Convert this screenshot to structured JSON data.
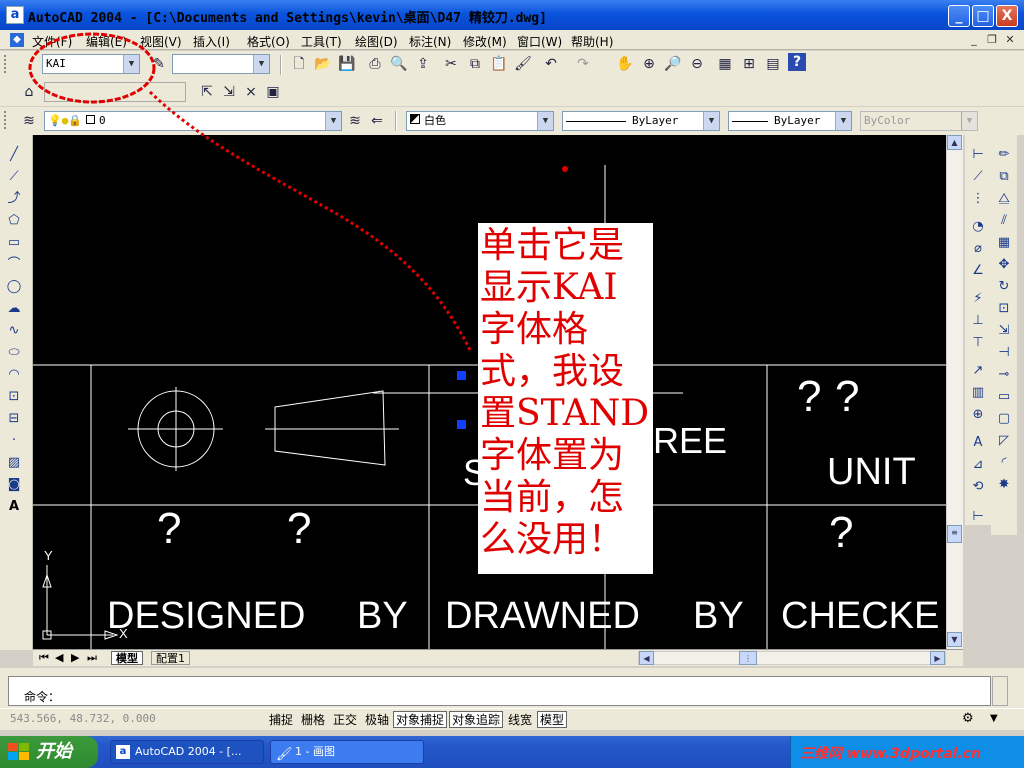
{
  "window": {
    "title": "AutoCAD 2004 - [C:\\Documents and Settings\\kevin\\桌面\\D47 精铰刀.dwg]",
    "controls": [
      "_",
      "□",
      "X"
    ]
  },
  "menu": [
    "文件(F)",
    "编辑(E)",
    "视图(V)",
    "插入(I)",
    "格式(O)",
    "工具(T)",
    "绘图(D)",
    "标注(N)",
    "修改(M)",
    "窗口(W)",
    "帮助(H)"
  ],
  "toolbar": {
    "text_style": "KAI",
    "layer": "0",
    "color": "白色",
    "linetype": "ByLayer",
    "lineweight": "ByLayer",
    "plotstyle": "ByColor"
  },
  "drawing": {
    "labels": {
      "designed": "DESIGNED",
      "by1": "BY",
      "drawned": "DRAWNED",
      "by2": "BY",
      "checked": "CHECKE",
      "unit": "UNIT",
      "degree": "REE",
      "s": "S"
    },
    "qmark": "?",
    "ucs": {
      "y": "Y",
      "x": "X"
    }
  },
  "note": "单击它是显示KAI字体格式，我设置STAND字体置为当前，怎么没用！",
  "layout_tabs": [
    "模型",
    "配置1"
  ],
  "command": {
    "prompt": "命令："
  },
  "status": {
    "coords": "543.566, 48.732, 0.000",
    "toggles": [
      "捕捉",
      "栅格",
      "正交",
      "极轴",
      "对象捕捉",
      "对象追踪",
      "线宽",
      "模型"
    ]
  },
  "taskbar": {
    "start": "开始",
    "tasks": [
      "AutoCAD 2004 - [...",
      "1 - 画图"
    ],
    "watermark": "三维网 www.3dportal.cn"
  },
  "colors": {
    "annotation_red": "#e00000",
    "canvas": "#000000",
    "title_blue": "#0a54dd"
  }
}
